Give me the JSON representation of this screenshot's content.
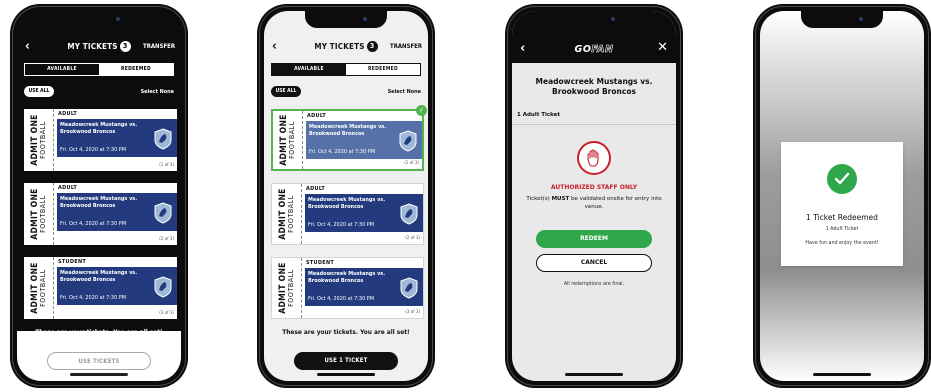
{
  "phones": {
    "list_available": {
      "title": "MY TICKETS",
      "count": "3",
      "transfer_label": "TRANSFER",
      "tabs": {
        "available": "AVAILABLE",
        "redeemed": "REDEEMED"
      },
      "use_all_label": "USE ALL",
      "select_none_label": "Select None",
      "tickets": [
        {
          "stub_line1": "ADMIT ONE",
          "stub_line2": "FOOTBALL",
          "type": "ADULT",
          "event": "Meadowcreek Mustangs vs. Brookwood Broncos",
          "date": "Fri. Oct 4, 2020 at 7:30 PM",
          "index": "(1 of 3)"
        },
        {
          "stub_line1": "ADMIT ONE",
          "stub_line2": "FOOTBALL",
          "type": "ADULT",
          "event": "Meadowcreek Mustangs vs. Brookwood Broncos",
          "date": "Fri. Oct 4, 2020 at 7:30 PM",
          "index": "(2 of 3)"
        },
        {
          "stub_line1": "ADMIT ONE",
          "stub_line2": "FOOTBALL",
          "type": "STUDENT",
          "event": "Meadowcreek Mustangs vs. Brookwood Broncos",
          "date": "Fri. Oct 4, 2020 at 7:30 PM",
          "index": "(3 of 3)"
        }
      ],
      "all_set_text": "These are your tickets. You are all set!",
      "action_label": "USE TICKETS"
    },
    "list_selected": {
      "title": "MY TICKETS",
      "count": "3",
      "transfer_label": "TRANSFER",
      "tabs": {
        "available": "AVAILABLE",
        "redeemed": "REDEEMED"
      },
      "use_all_label": "USE ALL",
      "select_none_label": "Select None",
      "tickets": [
        {
          "stub_line1": "ADMIT ONE",
          "stub_line2": "FOOTBALL",
          "type": "ADULT",
          "event": "Meadowcreek Mustangs vs. Brookwood Broncos",
          "date": "Fri. Oct 4, 2020 at 7:30 PM",
          "index": "(1 of 3)",
          "selected": true
        },
        {
          "stub_line1": "ADMIT ONE",
          "stub_line2": "FOOTBALL",
          "type": "ADULT",
          "event": "Meadowcreek Mustangs vs. Brookwood Broncos",
          "date": "Fri. Oct 4, 2020 at 7:30 PM",
          "index": "(2 of 3)"
        },
        {
          "stub_line1": "ADMIT ONE",
          "stub_line2": "FOOTBALL",
          "type": "STUDENT",
          "event": "Meadowcreek Mustangs vs. Brookwood Broncos",
          "date": "Fri. Oct 4, 2020 at 7:30 PM",
          "index": "(3 of 3)"
        }
      ],
      "all_set_text": "These are your tickets. You are all set!",
      "action_label": "USE 1 TICKET"
    },
    "redeem": {
      "logo_a": "GO",
      "logo_b": "FAN",
      "event": "Meadowcreek Mustangs vs. Brookwood Broncos",
      "ticket_count": "1 Adult Ticket",
      "auth_text": "AUTHORIZED STAFF ONLY",
      "must_pre": "Ticket(s) ",
      "must_bold": "MUST",
      "must_post": " be validated onsite for entry into venue.",
      "redeem_label": "REDEEM",
      "cancel_label": "CANCEL",
      "final_note": "All redemptions are final."
    },
    "success": {
      "title": "1 Ticket Redeemed",
      "subtitle": "1 Adult Ticket",
      "message": "Have fun and enjoy the event!"
    }
  },
  "colors": {
    "ticket_blue": "#233b7e",
    "success_green": "#2ea84a",
    "alert_red": "#c8202c"
  }
}
